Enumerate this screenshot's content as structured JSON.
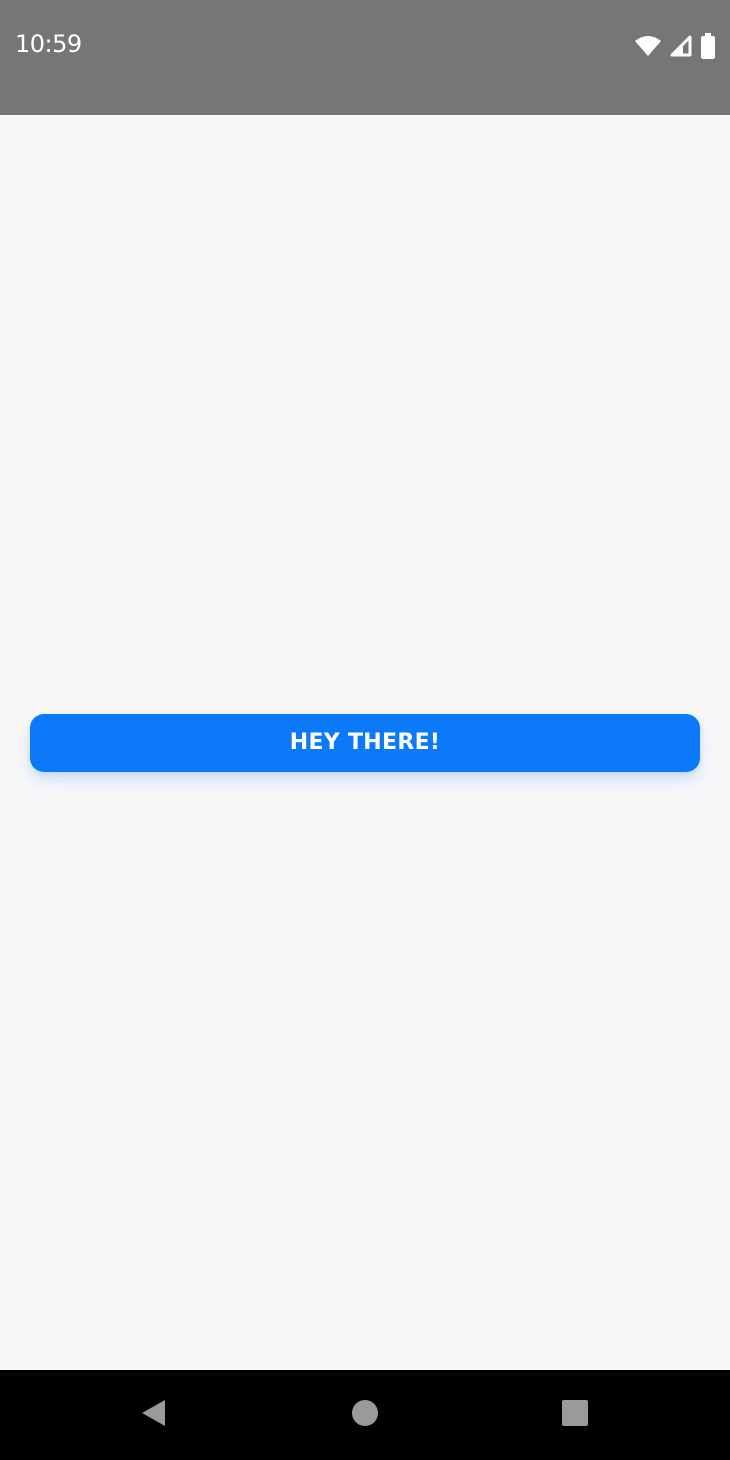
{
  "status_bar": {
    "time": "10:59",
    "icons": [
      "wifi-icon",
      "cellular-signal-icon",
      "battery-icon"
    ],
    "background": "#767676"
  },
  "main": {
    "button_label": "HEY THERE!",
    "button_color": "#0b79f8",
    "background": "#f8f8fa"
  },
  "nav_bar": {
    "icons": [
      "back-icon",
      "home-icon",
      "recents-icon"
    ],
    "background": "#000000"
  }
}
